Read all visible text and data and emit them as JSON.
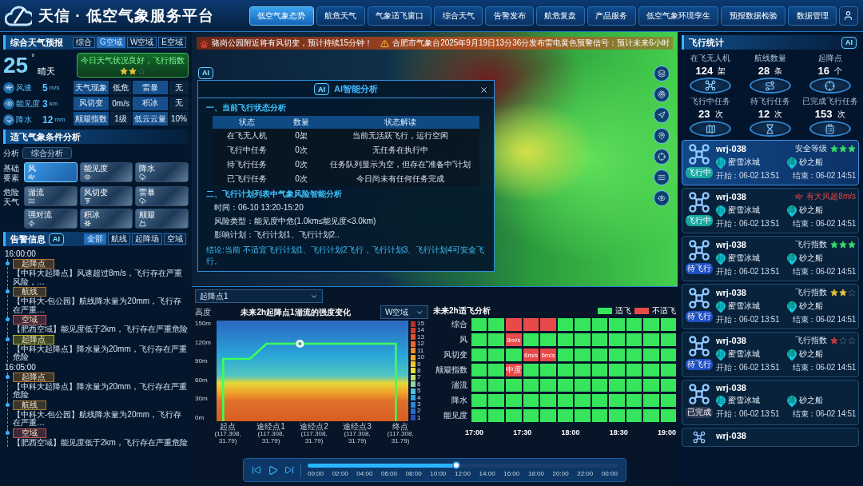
{
  "header": {
    "title": "天信 · 低空气象服务平台"
  },
  "nav": [
    {
      "label": "低空气象态势",
      "selected": true
    },
    {
      "label": "航危天气",
      "selected": false
    },
    {
      "label": "气象适飞窗口",
      "selected": false
    },
    {
      "label": "综合天气",
      "selected": false
    },
    {
      "label": "告警发布",
      "selected": false
    },
    {
      "label": "航危复盘",
      "selected": false
    },
    {
      "label": "产品服务",
      "selected": false
    },
    {
      "label": "低空气象环境孪生",
      "selected": false
    },
    {
      "label": "预报数据检验",
      "selected": false
    },
    {
      "label": "数据管理",
      "selected": false
    }
  ],
  "forecast": {
    "title": "综合天气预报",
    "tabs": [
      {
        "label": "综合",
        "selected": false
      },
      {
        "label": "G空域",
        "selected": true
      },
      {
        "label": "W空域",
        "selected": false
      },
      {
        "label": "E空域",
        "selected": false
      }
    ],
    "temperature": "25",
    "degree": "°",
    "condition": "晴天",
    "banner": {
      "text": "今日天气状况良好，飞行指数",
      "stars": 2
    },
    "metrics": [
      {
        "kind": "wind",
        "label": "风速",
        "value": "5",
        "unit": "m/s"
      },
      {
        "kind": "visibility",
        "label": "能见度",
        "value": "3",
        "unit": "km"
      },
      {
        "kind": "rain",
        "label": "降水",
        "value": "12",
        "unit": "mm"
      }
    ],
    "table": [
      [
        "天气现象",
        "低危",
        "雷暴",
        "无"
      ],
      [
        "风切变",
        "0m/s",
        "积冰",
        "无"
      ],
      [
        "颠簸指数",
        "1级",
        "低云云量",
        "10%"
      ]
    ]
  },
  "analysis": {
    "title": "适飞气象条件分析",
    "label": "分析",
    "button": "综合分析",
    "groups": [
      {
        "label": "基础要素",
        "tiles": [
          {
            "kind": "wind",
            "label": "风",
            "selected": true
          },
          {
            "kind": "visibility",
            "label": "能见度",
            "selected": false
          },
          {
            "kind": "rain",
            "label": "降水",
            "selected": false
          }
        ]
      },
      {
        "label": "危险天气",
        "tiles": [
          {
            "kind": "turbulence",
            "label": "湍流",
            "selected": false
          },
          {
            "kind": "shear",
            "label": "风切变",
            "selected": false
          },
          {
            "kind": "thunder",
            "label": "雷暴",
            "selected": false
          },
          {
            "kind": "convection",
            "label": "强对流",
            "selected": false
          },
          {
            "kind": "icing",
            "label": "积冰",
            "selected": false
          },
          {
            "kind": "bump",
            "label": "颠簸",
            "selected": false
          }
        ]
      }
    ]
  },
  "alerts": {
    "title": "告警信息",
    "ai_label": "AI",
    "tabs": [
      {
        "label": "全部",
        "selected": true
      },
      {
        "label": "航线",
        "selected": false
      },
      {
        "label": "起降场",
        "selected": false
      },
      {
        "label": "空域",
        "selected": false
      }
    ],
    "groups": [
      {
        "time": "16:00:00",
        "items": [
          {
            "tag": "起降点",
            "color": "#b8742a",
            "text": "【中科大起降点】风速超过8m/s，飞行存在严重风险，…"
          },
          {
            "tag": "航线",
            "color": "#a8782e",
            "text": "【中科大-包公园】航线降水量为20mm，飞行存在严重…"
          },
          {
            "tag": "空域",
            "color": "#c05252",
            "text": "【肥西空域】能见度低于2km，飞行存在严重危险"
          },
          {
            "tag": "起降点",
            "color": "#b5b020",
            "text": "【中科大起降点】降水量为20mm，飞行存在严重危险"
          }
        ]
      },
      {
        "time": "16:05:00",
        "items": [
          {
            "tag": "起降点",
            "color": "#b8742a",
            "text": "【中科大起降点】降水量为20mm，飞行存在严重危险"
          },
          {
            "tag": "航线",
            "color": "#a8782e",
            "text": "【中科大-包公园】航线降水量为20mm，飞行存在严重…"
          },
          {
            "tag": "空域",
            "color": "#c05252",
            "text": "【肥西空域】能见度低于2km，飞行存在严重危险"
          }
        ]
      }
    ]
  },
  "ticker": [
    {
      "kind": "alarm",
      "text": "骆岗公园附近将有风切变，预计持续15分钟！"
    },
    {
      "kind": "warning",
      "text": "合肥市气象台2025年9月19日13分36分发布雷电黄色预警信号：预计未来6小时"
    }
  ],
  "map_ai_label": "AI",
  "ai_popup": {
    "ai_label": "AI",
    "title": "AI智能分析",
    "section1": "一、当前飞行状态分析",
    "columns": [
      "状态",
      "数量",
      "状态解读"
    ],
    "rows": [
      [
        "在飞无人机",
        "0架",
        "当前无活跃飞行，运行空闲"
      ],
      [
        "飞行中任务",
        "0次",
        "无任务在执行中"
      ],
      [
        "待飞行任务",
        "0次",
        "任务队列显示为空，但存在“准备中”计划"
      ],
      [
        "已飞行任务",
        "0次",
        "今日尚未有任何任务完成"
      ]
    ],
    "section2": "二、飞行计划列表中气象风险智能分析",
    "lines": [
      "时间：06-10 13:20-15:20",
      "风险类型：能见度中危(1.0km≤能见度<3.0km)",
      "影响计划：飞行计划1、飞行计划2.."
    ],
    "conclusion": "结论:当前 不适宜飞行计划1、飞行计划2飞行，飞行计划3、飞行计划4可安全飞行。"
  },
  "bottom": {
    "location_select": "起降点1",
    "turbulence": {
      "title": "未来2h起降点1湍流的强度变化",
      "airspace_select": "W空域",
      "y_title": "高度",
      "y_ticks": [
        "150m",
        "120m",
        "90m",
        "60m",
        "30m",
        "0m"
      ],
      "x_labels": [
        {
          "name": "起点",
          "coord": "(117.308, 31.79)"
        },
        {
          "name": "途经点1",
          "coord": "(117.308, 31.79)"
        },
        {
          "name": "途经点2",
          "coord": "(117.308, 31.79)"
        },
        {
          "name": "途经点3",
          "coord": "(117.308, 31.79)"
        },
        {
          "name": "终点",
          "coord": "(117.308, 31.79)"
        }
      ],
      "legend": [
        "15",
        "14",
        "13",
        "12",
        "11",
        "10",
        "9",
        "8",
        "7",
        "6",
        "5",
        "4",
        "3",
        "2",
        "1"
      ]
    },
    "suitability": {
      "title": "未来2h适飞分析",
      "legend": [
        {
          "kind": "ok",
          "label": "适飞"
        },
        {
          "kind": "bad",
          "label": "不适飞"
        }
      ],
      "rows": [
        {
          "label": "综合",
          "cells": [
            {
              "suitable": true
            },
            {
              "suitable": true
            },
            {
              "suitable": false
            },
            {
              "suitable": false
            },
            {
              "suitable": false
            },
            {
              "suitable": true
            },
            {
              "suitable": true
            },
            {
              "suitable": true
            },
            {
              "suitable": true
            },
            {
              "suitable": true
            },
            {
              "suitable": true
            },
            {
              "suitable": true
            }
          ]
        },
        {
          "label": "风",
          "cells": [
            {
              "suitable": true
            },
            {
              "suitable": true
            },
            {
              "suitable": false,
              "text": "8m/s"
            },
            {
              "suitable": true
            },
            {
              "suitable": true
            },
            {
              "suitable": true
            },
            {
              "suitable": true
            },
            {
              "suitable": true
            },
            {
              "suitable": true
            },
            {
              "suitable": true
            },
            {
              "suitable": true
            },
            {
              "suitable": true
            }
          ]
        },
        {
          "label": "风切变",
          "cells": [
            {
              "suitable": true
            },
            {
              "suitable": true
            },
            {
              "suitable": true
            },
            {
              "suitable": false,
              "text": "6m/s"
            },
            {
              "suitable": false,
              "text": "6m/s"
            },
            {
              "suitable": true
            },
            {
              "suitable": true
            },
            {
              "suitable": true
            },
            {
              "suitable": true
            },
            {
              "suitable": true
            },
            {
              "suitable": true
            },
            {
              "suitable": true
            }
          ]
        },
        {
          "label": "颠簸指数",
          "cells": [
            {
              "suitable": true
            },
            {
              "suitable": true
            },
            {
              "suitable": false,
              "text": "中度"
            },
            {
              "suitable": true
            },
            {
              "suitable": true
            },
            {
              "suitable": true
            },
            {
              "suitable": true
            },
            {
              "suitable": true
            },
            {
              "suitable": true
            },
            {
              "suitable": true
            },
            {
              "suitable": true
            },
            {
              "suitable": true
            }
          ]
        },
        {
          "label": "湍流",
          "cells": [
            {
              "suitable": true
            },
            {
              "suitable": true
            },
            {
              "suitable": true
            },
            {
              "suitable": true
            },
            {
              "suitable": true
            },
            {
              "suitable": true
            },
            {
              "suitable": true
            },
            {
              "suitable": true
            },
            {
              "suitable": true
            },
            {
              "suitable": true
            },
            {
              "suitable": true
            },
            {
              "suitable": true
            }
          ]
        },
        {
          "label": "降水",
          "cells": [
            {
              "suitable": true
            },
            {
              "suitable": true
            },
            {
              "suitable": true
            },
            {
              "suitable": true
            },
            {
              "suitable": true
            },
            {
              "suitable": true
            },
            {
              "suitable": true
            },
            {
              "suitable": true
            },
            {
              "suitable": true
            },
            {
              "suitable": true
            },
            {
              "suitable": true
            },
            {
              "suitable": true
            }
          ]
        },
        {
          "label": "能见度",
          "cells": [
            {
              "suitable": true
            },
            {
              "suitable": true
            },
            {
              "suitable": true
            },
            {
              "suitable": true
            },
            {
              "suitable": true
            },
            {
              "suitable": true
            },
            {
              "suitable": true
            },
            {
              "suitable": true
            },
            {
              "suitable": true
            },
            {
              "suitable": true
            },
            {
              "suitable": true
            },
            {
              "suitable": true
            }
          ]
        }
      ],
      "times": [
        "17:00",
        "17:30",
        "18:00",
        "18:30",
        "19:00"
      ]
    },
    "timeline": {
      "level": 0.48,
      "ticks": [
        "00:00",
        "02:00",
        "04:00",
        "06:00",
        "08:00",
        "10:00",
        "12:00",
        "14:00",
        "16:00",
        "18:00",
        "20:00",
        "22:00",
        "00:00"
      ]
    }
  },
  "flight_stats": {
    "title": "飞行统计",
    "ai_label": "AI",
    "stats": [
      {
        "kind": "drone",
        "label": "在飞无人机",
        "value": "124",
        "unit": "架"
      },
      {
        "kind": "route",
        "label": "航线数量",
        "value": "28",
        "unit": "条"
      },
      {
        "kind": "pad",
        "label": "起降点",
        "value": "16",
        "unit": "个"
      },
      {
        "kind": "flying",
        "label": "飞行中任务",
        "value": "23",
        "unit": "次"
      },
      {
        "kind": "waiting",
        "label": "待飞行任务",
        "value": "12",
        "unit": "次"
      },
      {
        "kind": "done",
        "label": "已完成飞行任务",
        "value": "153",
        "unit": "次"
      }
    ],
    "cards": [
      {
        "name": "wrj-038",
        "selected": true,
        "status": {
          "label": "飞行中",
          "color": "#1aa7a0"
        },
        "rating": {
          "kind": "stars",
          "label": "安全等级",
          "stars": 3
        },
        "start_mark": "起",
        "start": "蜜雪冰城",
        "end_mark": "降",
        "end": "砂之船",
        "start_time": "开始：06-02 13:51",
        "end_time": "结束：06-02 14:51"
      },
      {
        "name": "wrj-038",
        "selected": false,
        "status": {
          "label": "飞行中",
          "color": "#1aa7a0"
        },
        "rating": {
          "kind": "warning",
          "text": "有大风超8m/s"
        },
        "start_mark": "起",
        "start": "蜜雪冰城",
        "end_mark": "降",
        "end": "砂之船",
        "start_time": "开始：06-02 13:51",
        "end_time": "结束：06-02 14:51"
      },
      {
        "name": "wrj-038",
        "selected": false,
        "status": {
          "label": "待飞行",
          "color": "#1c4fc0"
        },
        "rating": {
          "kind": "stars",
          "label": "飞行指数",
          "stars": 3
        },
        "start_mark": "起",
        "start": "蜜雪冰城",
        "end_mark": "降",
        "end": "砂之船",
        "start_time": "开始：06-02 13:51",
        "end_time": "结束：06-02 14:51"
      },
      {
        "name": "wrj-038",
        "selected": false,
        "status": {
          "label": "待飞行",
          "color": "#1c4fc0"
        },
        "rating": {
          "kind": "stars",
          "label": "飞行指数",
          "stars": 2
        },
        "start_mark": "起",
        "start": "蜜雪冰城",
        "end_mark": "降",
        "end": "砂之船",
        "start_time": "开始：06-02 13:51",
        "end_time": "结束：06-02 14:51"
      },
      {
        "name": "wrj-038",
        "selected": false,
        "status": {
          "label": "待飞行",
          "color": "#1c4fc0"
        },
        "rating": {
          "kind": "stars",
          "label": "飞行指数",
          "stars": 1
        },
        "start_mark": "起",
        "start": "蜜雪冰城",
        "end_mark": "降",
        "end": "砂之船",
        "start_time": "开始：06-02 13:51",
        "end_time": "结束：06-02 14:51"
      },
      {
        "name": "wrj-038",
        "selected": false,
        "status": {
          "label": "已完成",
          "color": "#2c3a52"
        },
        "start_mark": "起",
        "start": "蜜雪冰城",
        "end_mark": "降",
        "end": "砂之船",
        "start_time": "开始：06-02 13:51",
        "end_time": "结束：06-02 14:51"
      },
      {
        "name": "wrj-038",
        "selected": false
      }
    ]
  }
}
